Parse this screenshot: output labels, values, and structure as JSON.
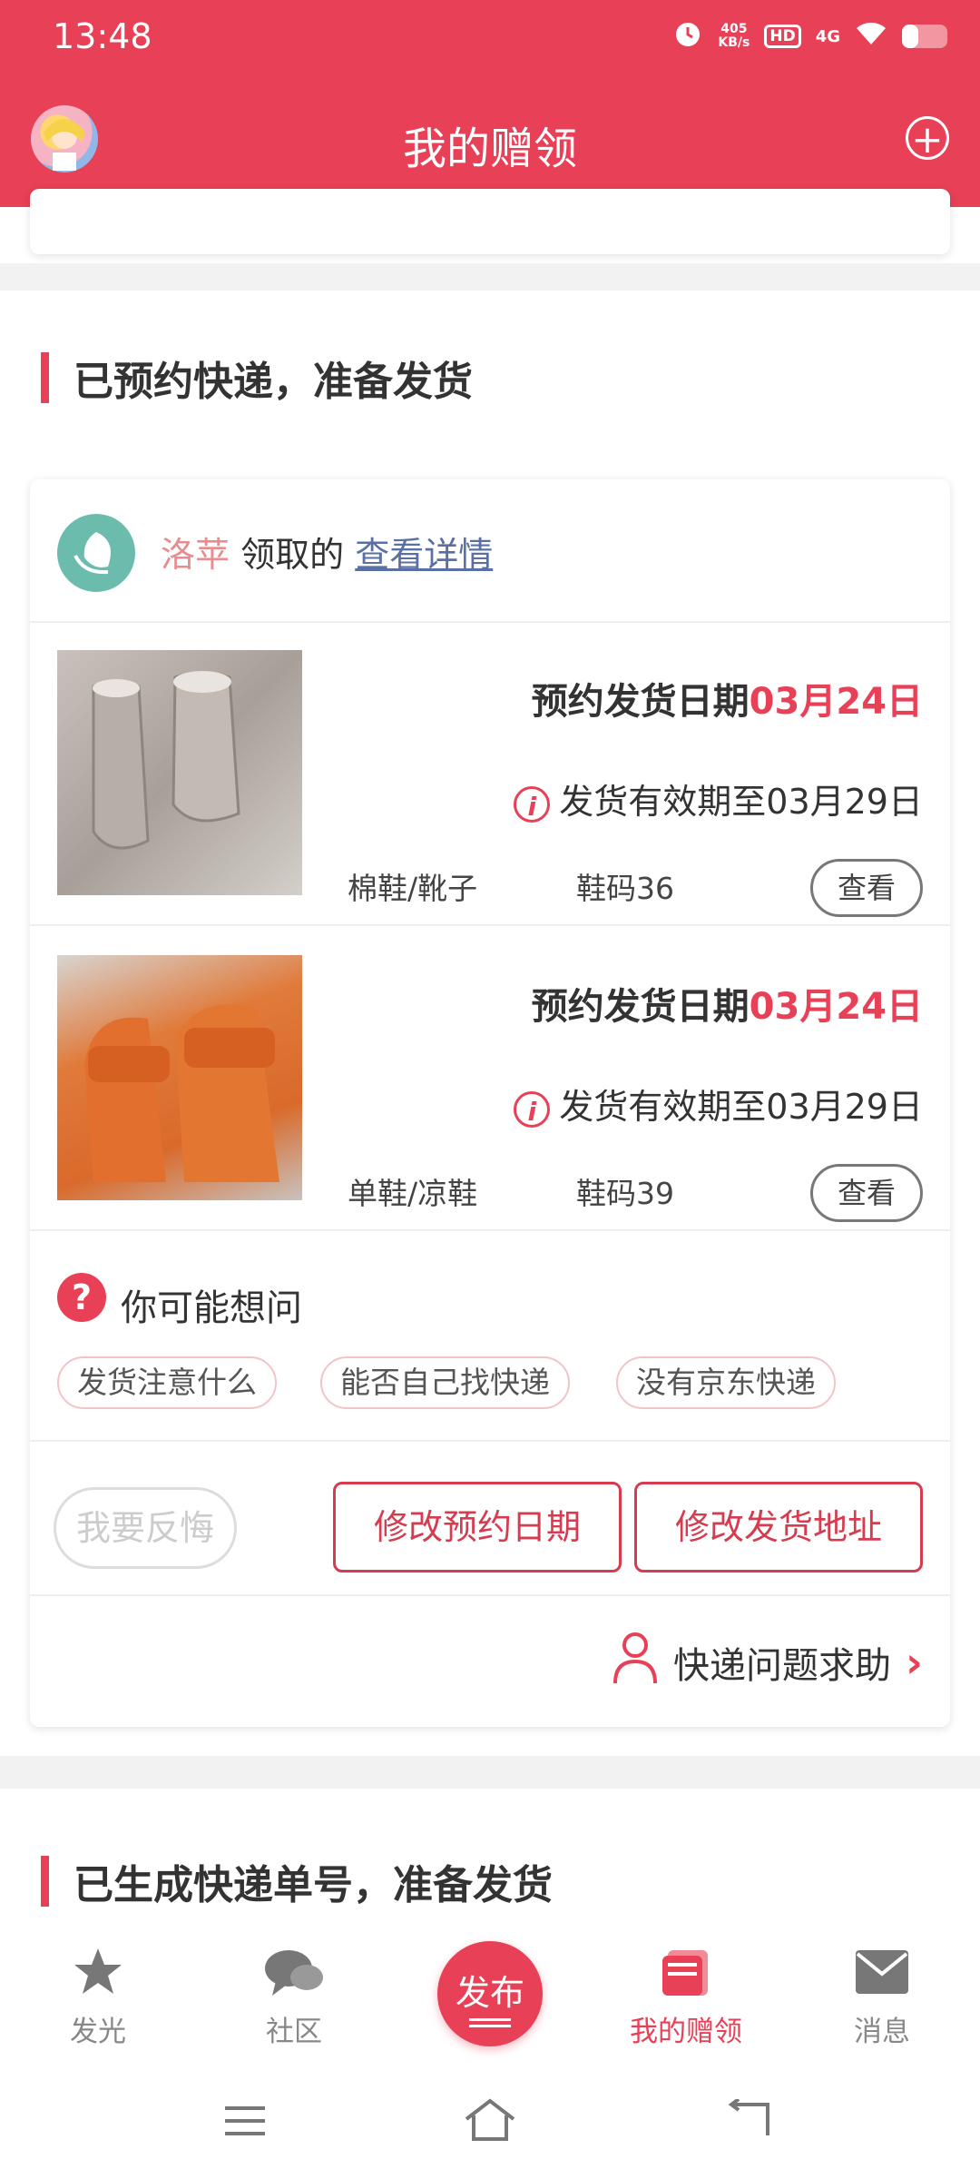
{
  "status_bar": {
    "time": "13:48",
    "network_speed": "405\nKB/s",
    "hd": "HD",
    "signal": "4G",
    "battery_level": 0.35
  },
  "header": {
    "title": "我的赠领",
    "avatar_icon": "avatar-icon",
    "add_icon": "plus-circle-icon"
  },
  "section1": {
    "title": "已预约快递，准备发货"
  },
  "card": {
    "org_icon": "leaf-logo-icon",
    "giver_name": "洛苹",
    "giver_text": "领取的",
    "detail_link": "查看详情",
    "items": [
      {
        "date_label": "预约发货日期",
        "date_value": "03月24日",
        "valid_text": "发货有效期至03月29日",
        "category": "棉鞋/靴子",
        "size": "鞋码36",
        "view_label": "查看"
      },
      {
        "date_label": "预约发货日期",
        "date_value": "03月24日",
        "valid_text": "发货有效期至03月29日",
        "category": "单鞋/凉鞋",
        "size": "鞋码39",
        "view_label": "查看"
      }
    ],
    "faq_title": "你可能想问",
    "faq_chips": [
      "发货注意什么",
      "能否自己找快递",
      "没有京东快递"
    ],
    "regret_label": "我要反悔",
    "change_date_label": "修改预约日期",
    "change_address_label": "修改发货地址",
    "help_label": "快递问题求助"
  },
  "section2": {
    "title": "已生成快递单号，准备发货"
  },
  "tabbar": {
    "tabs": [
      {
        "label": "发光",
        "icon": "star-icon"
      },
      {
        "label": "社区",
        "icon": "chat-bubbles-icon"
      },
      {
        "label": "我的赠领",
        "icon": "gift-box-icon"
      },
      {
        "label": "消息",
        "icon": "envelope-icon"
      }
    ],
    "publish_label": "发布"
  },
  "colors": {
    "accent": "#e84056",
    "button_border": "#d63c4f",
    "link": "#5a6fa4"
  }
}
